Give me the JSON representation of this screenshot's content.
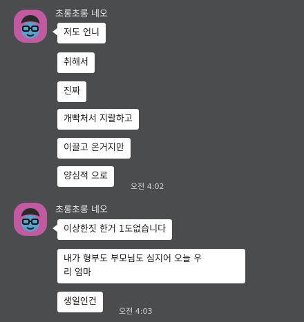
{
  "messages": [
    {
      "sender": "초롱초롱 네오",
      "avatar_icon": "neo-avatar-icon",
      "bubbles": [
        "저도 언니",
        "취해서",
        "진짜",
        "개빡처서 지랄하고",
        "이끌고 온거지만",
        "양심적 으로"
      ],
      "time": "오전 4:02"
    },
    {
      "sender": "초롱초롱 네오",
      "avatar_icon": "neo-avatar-icon",
      "bubbles": [
        "이상한짓 한거 1도없습니다",
        "내가 형부도 부모님도 심지어 오늘 우리 엄마",
        "생일인건"
      ],
      "bubble_lines": {
        "1": [
          "내가 형부도 부모님도 심지어 오늘 우",
          "리 엄마"
        ]
      },
      "time": "오전 4:03"
    }
  ],
  "colors": {
    "background": "#4b4c4e",
    "bubble": "#ffffff",
    "avatar_bg": "#c25aa2"
  }
}
